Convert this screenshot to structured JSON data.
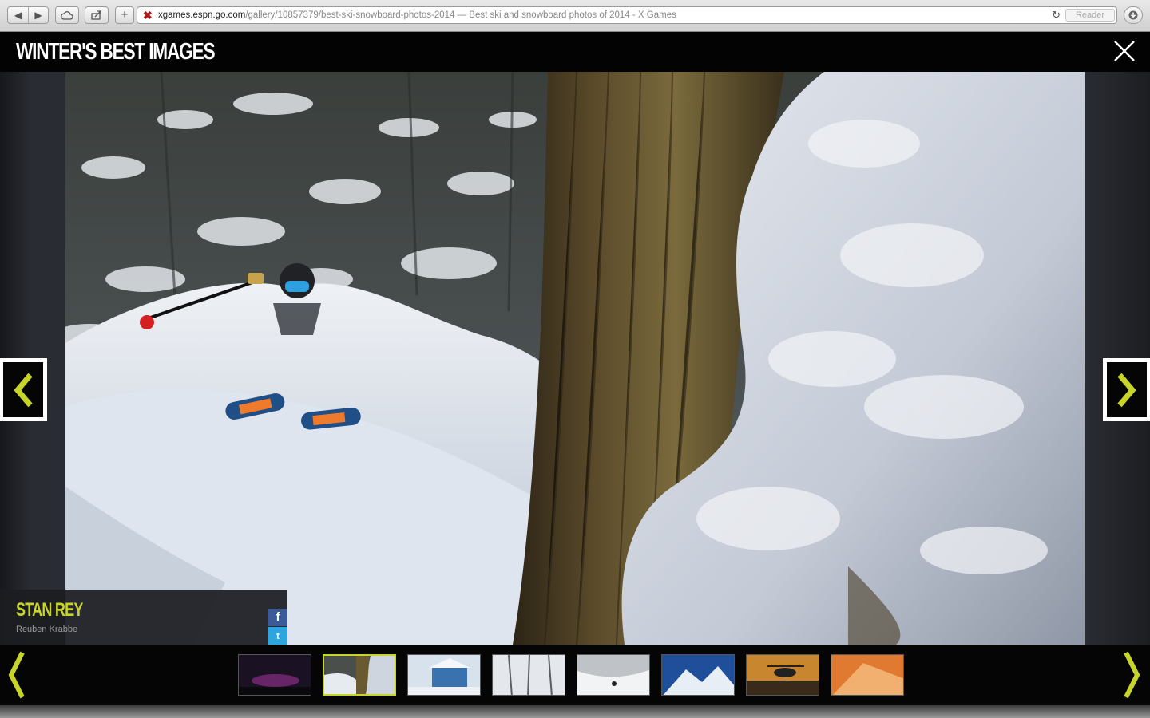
{
  "browser": {
    "url_host": "xgames.espn.go.com",
    "url_path": "/gallery/10857379/best-ski-snowboard-photos-2014",
    "page_title": " — Best ski and snowboard photos of 2014 - X Games",
    "reader_label": "Reader",
    "back_glyph": "◀",
    "forward_glyph": "▶",
    "newtab_glyph": "+",
    "reload_glyph": "↻"
  },
  "gallery": {
    "title": "WINTER'S BEST IMAGES"
  },
  "caption": {
    "name": "STAN REY",
    "credit": "Reuben Krabbe"
  },
  "share": {
    "facebook_glyph": "f",
    "twitter_glyph": "t"
  },
  "colors": {
    "accent": "#c7d529",
    "facebook": "#3b5a9a",
    "twitter": "#2da6e0"
  },
  "filmstrip": {
    "thumbs": [
      {
        "name": "thumb-aurora",
        "active": false
      },
      {
        "name": "thumb-skier-tree",
        "active": true
      },
      {
        "name": "thumb-snow-building",
        "active": false
      },
      {
        "name": "thumb-snow-trees",
        "active": false
      },
      {
        "name": "thumb-halfpipe",
        "active": false
      },
      {
        "name": "thumb-mountains",
        "active": false
      },
      {
        "name": "thumb-helicopter",
        "active": false
      },
      {
        "name": "thumb-sunset-slope",
        "active": false
      }
    ]
  }
}
